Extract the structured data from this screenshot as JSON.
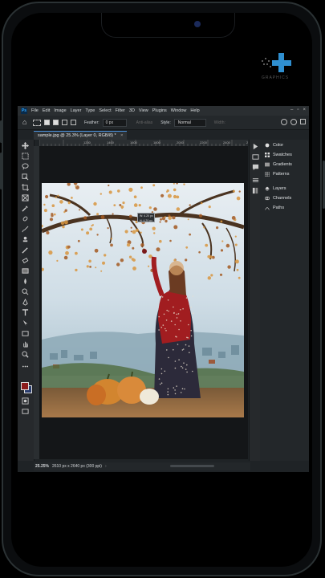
{
  "menubar": {
    "items": [
      "File",
      "Edit",
      "Image",
      "Layer",
      "Type",
      "Select",
      "Filter",
      "3D",
      "View",
      "Plugins",
      "Window",
      "Help"
    ]
  },
  "options": {
    "feather_label": "Feather:",
    "feather_value": "0 px",
    "antialias_label": "Anti-alias",
    "style_label": "Style:",
    "style_value": "Normal",
    "width_label": "Width:"
  },
  "document": {
    "tab_title": "sample.jpg @ 25.3% (Layer 0, RGB/8) *",
    "ruler_ticks": [
      "1200",
      "1400",
      "1600",
      "1800",
      "2000",
      "2200",
      "2400",
      "2600"
    ],
    "selection_readout_line1": "W: 4.20 px",
    "selection_readout_line2": "H: 4.20 px"
  },
  "status": {
    "zoom": "25.25%",
    "info": "2610 px x 2640 px (300 ppi)"
  },
  "panels": {
    "group1": [
      "Color",
      "Swatches",
      "Gradients",
      "Patterns"
    ],
    "group2": [
      "Layers",
      "Channels",
      "Paths"
    ]
  },
  "colors": {
    "foreground": "#8b1c1c",
    "background": "#2a3d6e",
    "accent": "#4a90d9"
  }
}
